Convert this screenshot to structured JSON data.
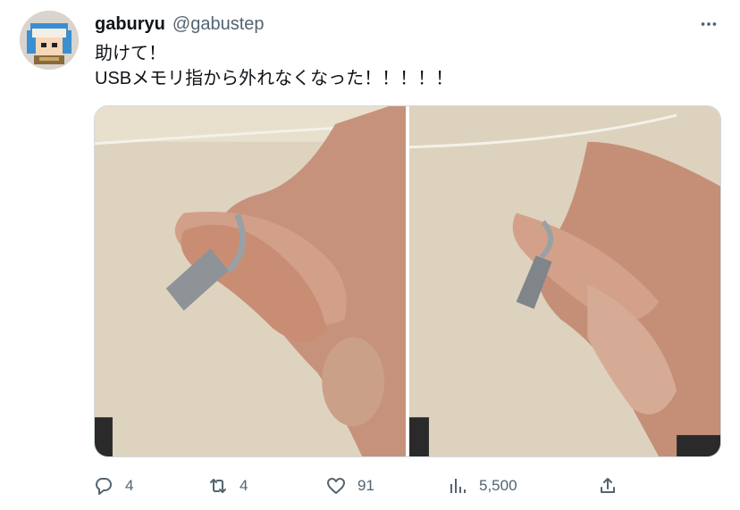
{
  "tweet": {
    "display_name": "gaburyu",
    "handle": "@gabustep",
    "text": "助けて！\nUSBメモリ指から外れなくなった！！！！！",
    "more_icon": "more-horizontal-icon",
    "avatar_icon": "pixel-avatar"
  },
  "media": [
    {
      "icon": "photo-hand-usb-ring-1"
    },
    {
      "icon": "photo-hand-usb-ring-2"
    }
  ],
  "actions": {
    "reply_count": "4",
    "retweet_count": "4",
    "like_count": "91",
    "view_count": "5,500",
    "reply_icon": "reply-icon",
    "retweet_icon": "retweet-icon",
    "like_icon": "heart-icon",
    "views_icon": "views-icon",
    "share_icon": "share-icon"
  },
  "colors": {
    "text": "#0f1419",
    "secondary": "#536471",
    "border": "#cfd9de"
  }
}
